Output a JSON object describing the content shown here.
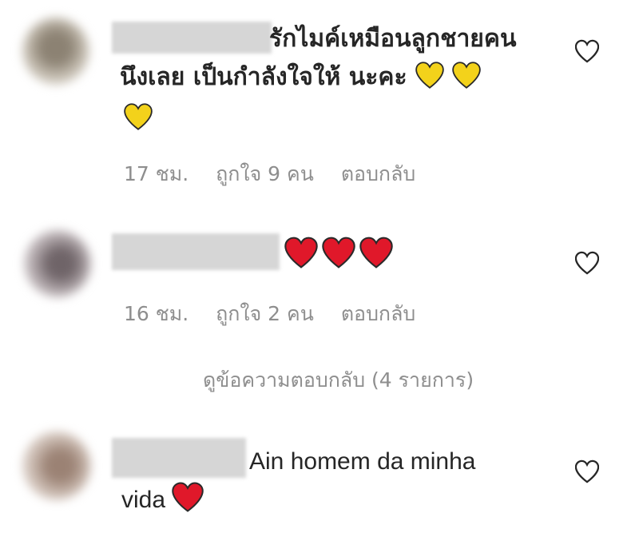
{
  "comments": [
    {
      "text_line1": "รักไมค์เหมือนลูกชายคน",
      "text_line2": "นึงเลย เป็นกำลังใจให้ นะคะ",
      "emojis": [
        "yellow-heart",
        "yellow-heart",
        "yellow-heart"
      ],
      "time": "17 ชม.",
      "likes": "ถูกใจ 9 คน",
      "reply": "ตอบกลับ"
    },
    {
      "emojis": [
        "red-heart",
        "red-heart",
        "red-heart"
      ],
      "time": "16 ชม.",
      "likes": "ถูกใจ 2 คน",
      "reply": "ตอบกลับ",
      "view_replies": "ดูข้อความตอบกลับ (4 รายการ)"
    },
    {
      "text_line1": "Ain homem da minha",
      "text_line2": "vida",
      "emojis": [
        "red-heart"
      ]
    }
  ],
  "colors": {
    "yellow_heart": "#f3d21b",
    "red_heart": "#e0182a",
    "muted": "#8e8e8e"
  }
}
